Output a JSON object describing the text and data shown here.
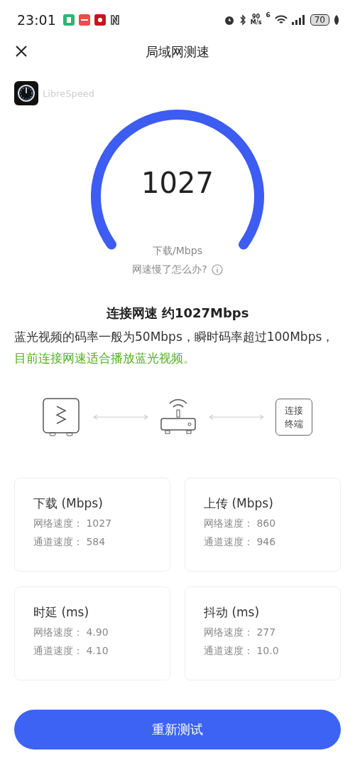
{
  "status_bar": {
    "time": "23:01",
    "net_speed_value": "90",
    "net_speed_unit": "M/s",
    "wifi_badge": "6",
    "battery": "70"
  },
  "header": {
    "title": "局域网测速"
  },
  "app": {
    "name": "LibreSpeed"
  },
  "gauge": {
    "value": "1027",
    "unit": "下载/Mbps",
    "help": "网速慢了怎么办?"
  },
  "summary": {
    "title": "连接网速 约1027Mbps",
    "text": "蓝光视频的码率一般为50Mbps，瞬时码率超过100Mbps，",
    "highlight": "目前连接网速适合播放蓝光视频。"
  },
  "topology": {
    "terminal_label": "连接终端"
  },
  "cards": [
    {
      "title": "下载 (Mbps)",
      "rows": [
        {
          "label": "网络速度：",
          "value": "1027"
        },
        {
          "label": "通道速度：",
          "value": "584"
        }
      ]
    },
    {
      "title": "上传 (Mbps)",
      "rows": [
        {
          "label": "网络速度：",
          "value": "860"
        },
        {
          "label": "通道速度：",
          "value": "946"
        }
      ]
    },
    {
      "title": "时延 (ms)",
      "rows": [
        {
          "label": "网络速度：",
          "value": "4.90"
        },
        {
          "label": "通道速度：",
          "value": "4.10"
        }
      ]
    },
    {
      "title": "抖动 (ms)",
      "rows": [
        {
          "label": "网络速度：",
          "value": "277"
        },
        {
          "label": "通道速度：",
          "value": "10.0"
        }
      ]
    }
  ],
  "retest_button": "重新测试"
}
